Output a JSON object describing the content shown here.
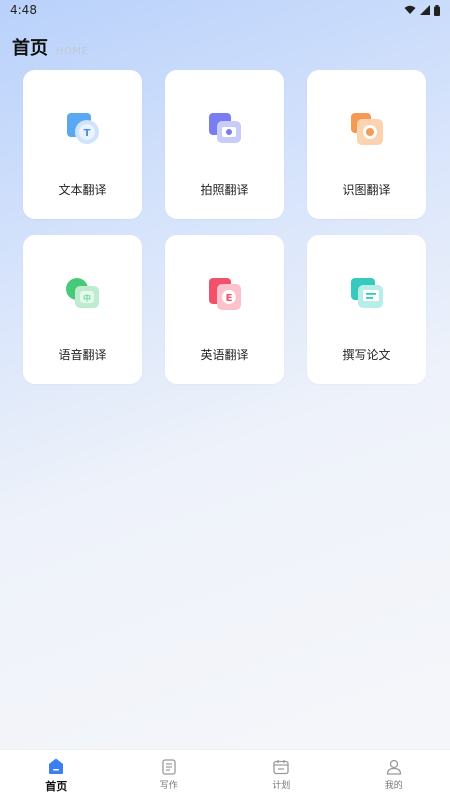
{
  "status_bar": {
    "time": "4:48"
  },
  "header": {
    "title": "首页",
    "subtitle": "HOME"
  },
  "cards": [
    {
      "label": "文本翻译",
      "icon": "text-translate-icon",
      "color": "#5aa7f2"
    },
    {
      "label": "拍照翻译",
      "icon": "camera-translate-icon",
      "color": "#7a7cf2"
    },
    {
      "label": "识图翻译",
      "icon": "image-translate-icon",
      "color": "#f59a55"
    },
    {
      "label": "语音翻译",
      "icon": "voice-translate-icon",
      "color": "#47c97a"
    },
    {
      "label": "英语翻译",
      "icon": "english-translate-icon",
      "color": "#f2516b"
    },
    {
      "label": "撰写论文",
      "icon": "paper-writing-icon",
      "color": "#37c9be"
    }
  ],
  "tabs": [
    {
      "label": "首页",
      "icon": "home-icon",
      "active": true
    },
    {
      "label": "写作",
      "icon": "document-icon"
    },
    {
      "label": "计划",
      "icon": "calendar-icon"
    },
    {
      "label": "我的",
      "icon": "user-icon"
    }
  ],
  "colors": {
    "accent": "#3d7ff0"
  }
}
